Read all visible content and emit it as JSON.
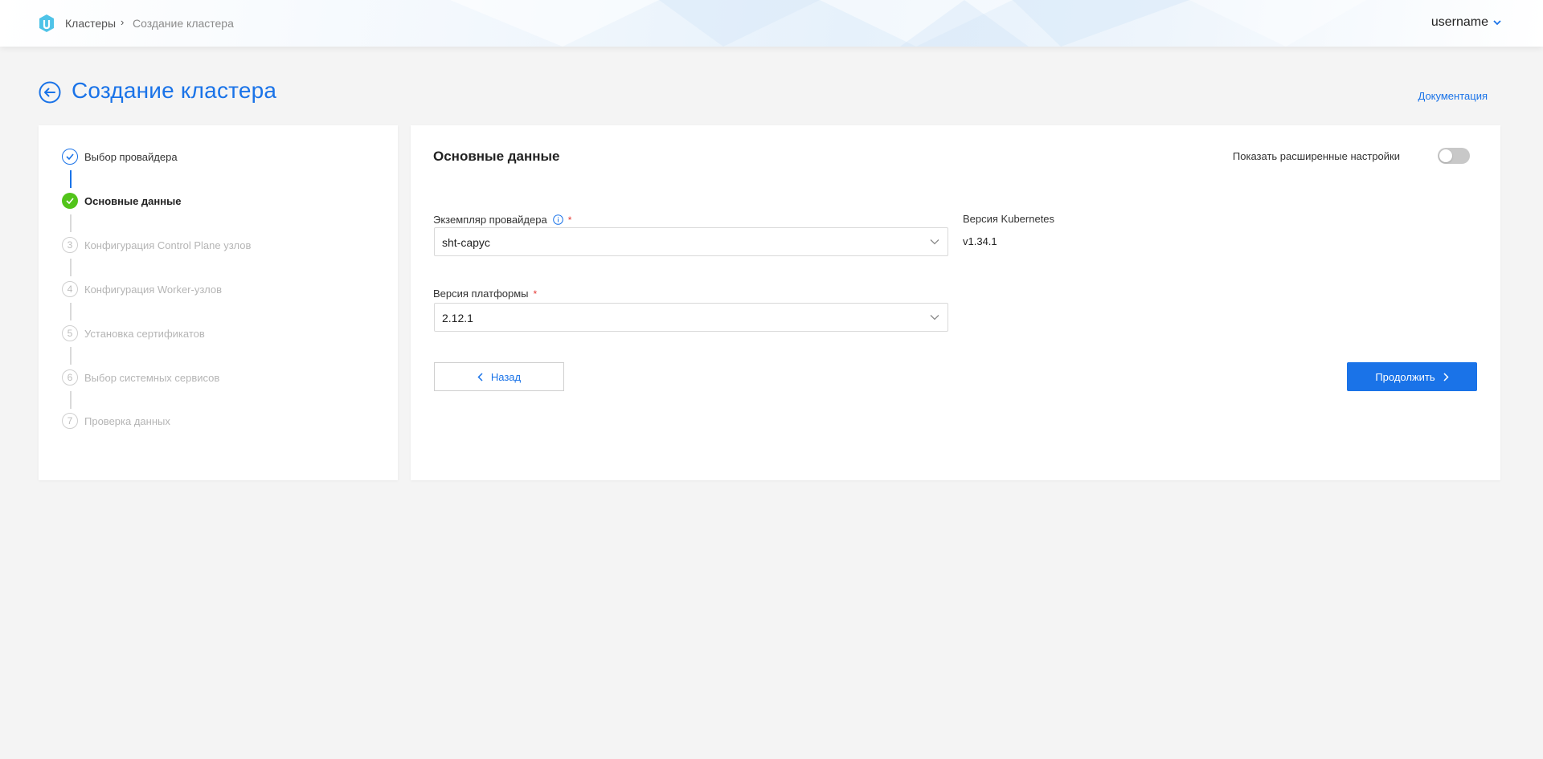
{
  "header": {
    "breadcrumb": [
      "Кластеры",
      "Создание кластера"
    ],
    "breadcrumb_separator": "›",
    "username": "username"
  },
  "page": {
    "title": "Создание кластера",
    "documentation_link": "Документация"
  },
  "steps": [
    {
      "number": "1",
      "label": "Выбор провайдера",
      "state": "done"
    },
    {
      "number": "2",
      "label": "Основные данные",
      "state": "current"
    },
    {
      "number": "3",
      "label": "Конфигурация Control Plane узлов",
      "state": "todo"
    },
    {
      "number": "4",
      "label": "Конфигурация Worker-узлов",
      "state": "todo"
    },
    {
      "number": "5",
      "label": "Установка сертификатов",
      "state": "todo"
    },
    {
      "number": "6",
      "label": "Выбор системных сервисов",
      "state": "todo"
    },
    {
      "number": "7",
      "label": "Проверка данных",
      "state": "todo"
    }
  ],
  "form": {
    "section_title": "Основные данные",
    "advanced_settings_label": "Показать расширенные настройки",
    "advanced_settings_enabled": false,
    "provider_instance": {
      "label": "Экземпляр провайдера",
      "required_mark": "*",
      "value": "sht-capyc"
    },
    "platform_version": {
      "label": "Версия платформы",
      "required_mark": "*",
      "value": "2.12.1"
    },
    "kubernetes_version": {
      "label": "Версия Kubernetes",
      "value": "v1.34.1"
    },
    "back_button": "Назад",
    "continue_button": "Продолжить"
  },
  "colors": {
    "accent": "#1a73e8",
    "step_current": "#52c41a",
    "background": "#f4f4f4",
    "required": "#e53935"
  }
}
